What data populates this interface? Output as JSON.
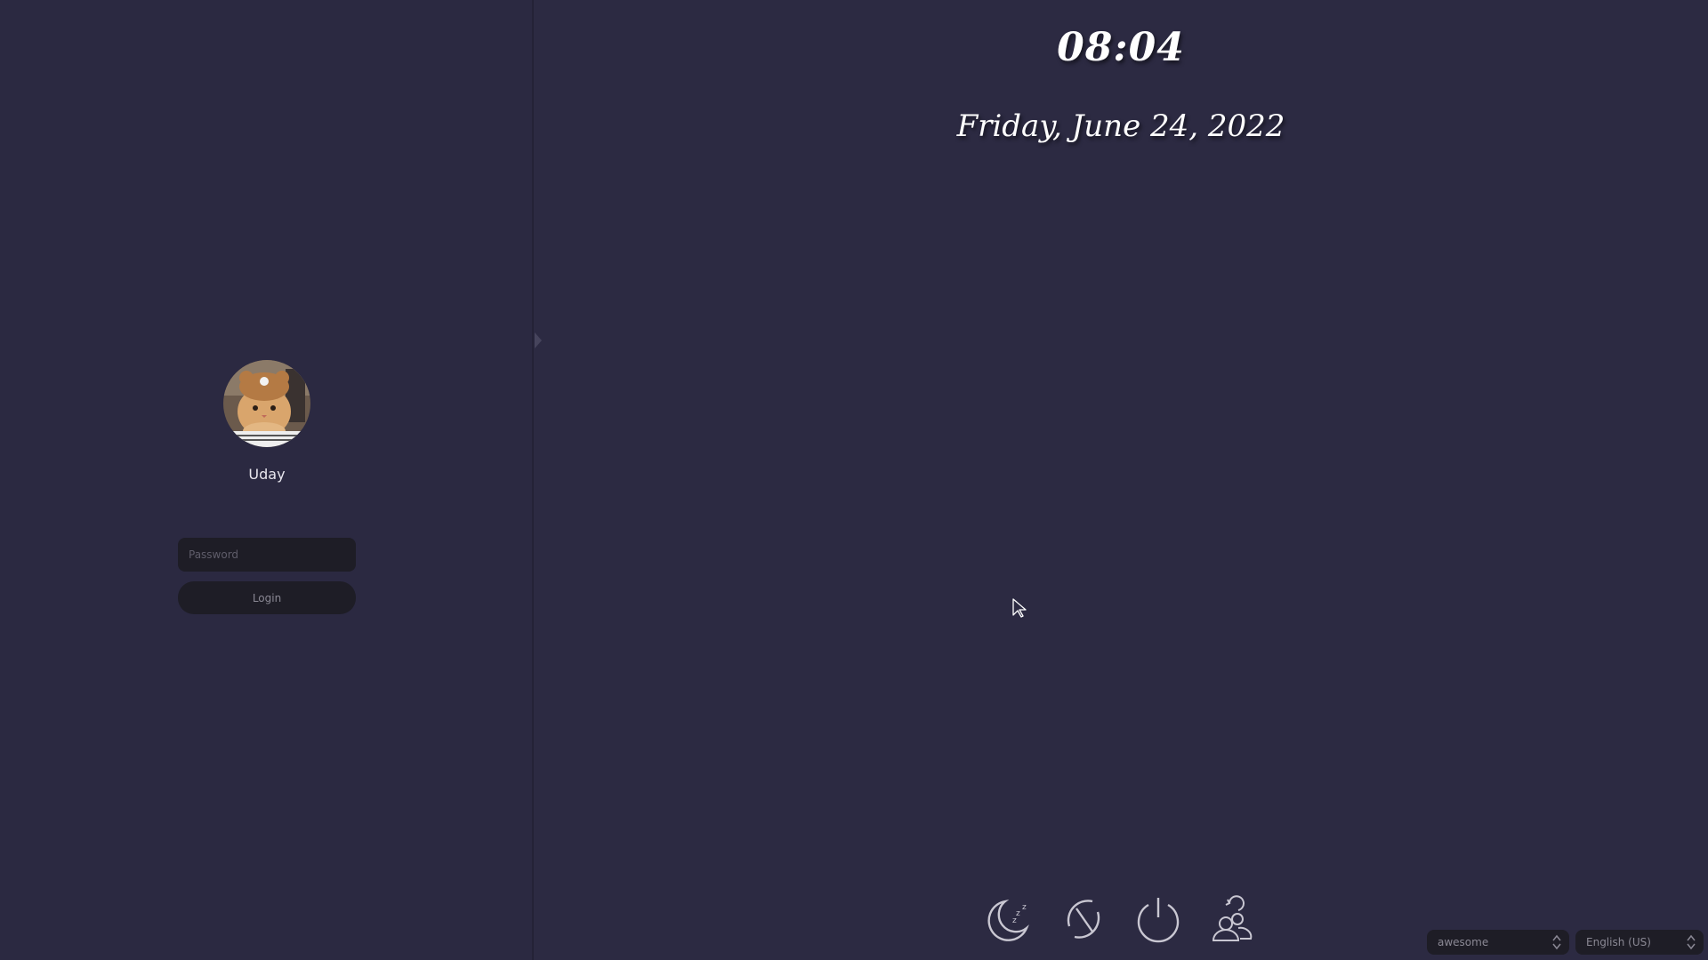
{
  "clock": {
    "time": "08:04",
    "date": "Friday, June 24, 2022"
  },
  "user": {
    "name": "Uday",
    "avatar": "cat-avatar"
  },
  "login": {
    "password_placeholder": "Password",
    "button_label": "Login"
  },
  "power": {
    "icons": [
      "suspend-icon",
      "restart-icon",
      "shutdown-icon",
      "switch-user-icon"
    ]
  },
  "session": {
    "selected": "awesome"
  },
  "language": {
    "selected": "English (US)"
  },
  "colors": {
    "background": "#2c2a42",
    "panel": "#2b2941",
    "field": "#1e1d26",
    "text": "#ffffff",
    "icon": "#c9c7d2"
  }
}
